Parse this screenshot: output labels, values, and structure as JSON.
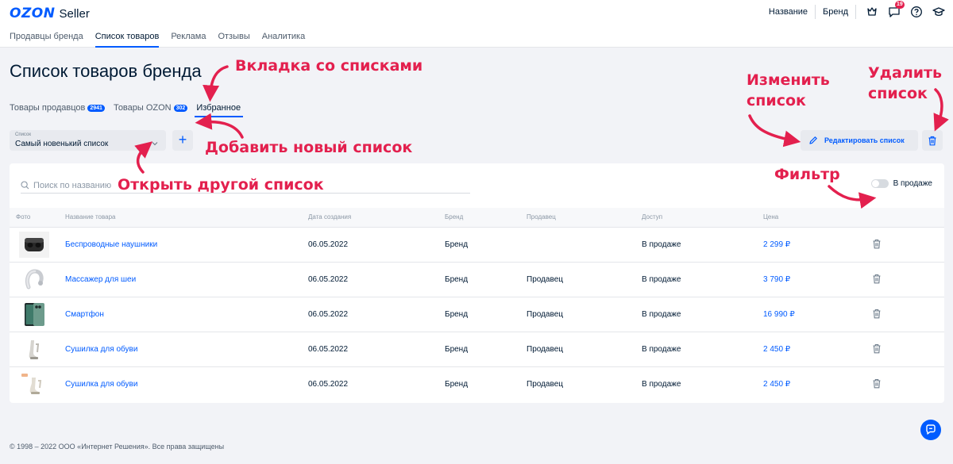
{
  "header": {
    "logo_brand": "OZON",
    "logo_product": "Seller",
    "nav": [
      "Продавцы бренда",
      "Список товаров",
      "Реклама",
      "Отзывы",
      "Аналитика"
    ],
    "right_links": [
      "Название",
      "Бренд"
    ],
    "notifications_count": "19"
  },
  "page": {
    "title": "Список товаров бренда",
    "tabs": [
      {
        "label": "Товары продавцов",
        "count": "2941"
      },
      {
        "label": "Товары OZON",
        "count": "302"
      },
      {
        "label": "Избранное",
        "count": ""
      }
    ]
  },
  "list": {
    "select_label": "Список",
    "select_value": "Самый новенький список",
    "add_label": "+",
    "edit_label": "Редактировать список"
  },
  "table": {
    "search_placeholder": "Поиск по названию",
    "filter_label": "В продаже",
    "headers": [
      "Фото",
      "Название товара",
      "Дата создания",
      "Бренд",
      "Продавец",
      "Доступ",
      "Цена"
    ],
    "rows": [
      {
        "name": "Беспроводные наушники",
        "date": "06.05.2022",
        "brand": "Бренд",
        "seller": "",
        "access": "В продаже",
        "price": "2 299 ₽"
      },
      {
        "name": "Массажер для шеи",
        "date": "06.05.2022",
        "brand": "Бренд",
        "seller": "Продавец",
        "access": "В продаже",
        "price": "3 790 ₽"
      },
      {
        "name": "Смартфон",
        "date": "06.05.2022",
        "brand": "Бренд",
        "seller": "Продавец",
        "access": "В продаже",
        "price": "16 990 ₽"
      },
      {
        "name": "Сушилка для обуви",
        "date": "06.05.2022",
        "brand": "Бренд",
        "seller": "Продавец",
        "access": "В продаже",
        "price": "2 450 ₽"
      },
      {
        "name": "Сушилка для обуви",
        "date": "06.05.2022",
        "brand": "Бренд",
        "seller": "Продавец",
        "access": "В продаже",
        "price": "2 450 ₽"
      }
    ]
  },
  "footer": {
    "copyright": "© 1998 – 2022 ООО «Интернет Решения». Все права защищены"
  },
  "annotations": {
    "tab_lists": "Вкладка со списками",
    "add_list": "Добавить новый список",
    "open_list": "Открыть другой список",
    "edit_list_line1": "Изменить",
    "edit_list_line2": "список",
    "delete_list_line1": "Удалить",
    "delete_list_line2": "список",
    "filter": "Фильтр"
  },
  "colors": {
    "accent": "#005bff",
    "annotation": "#e3204e",
    "background": "#f2f3f7"
  }
}
